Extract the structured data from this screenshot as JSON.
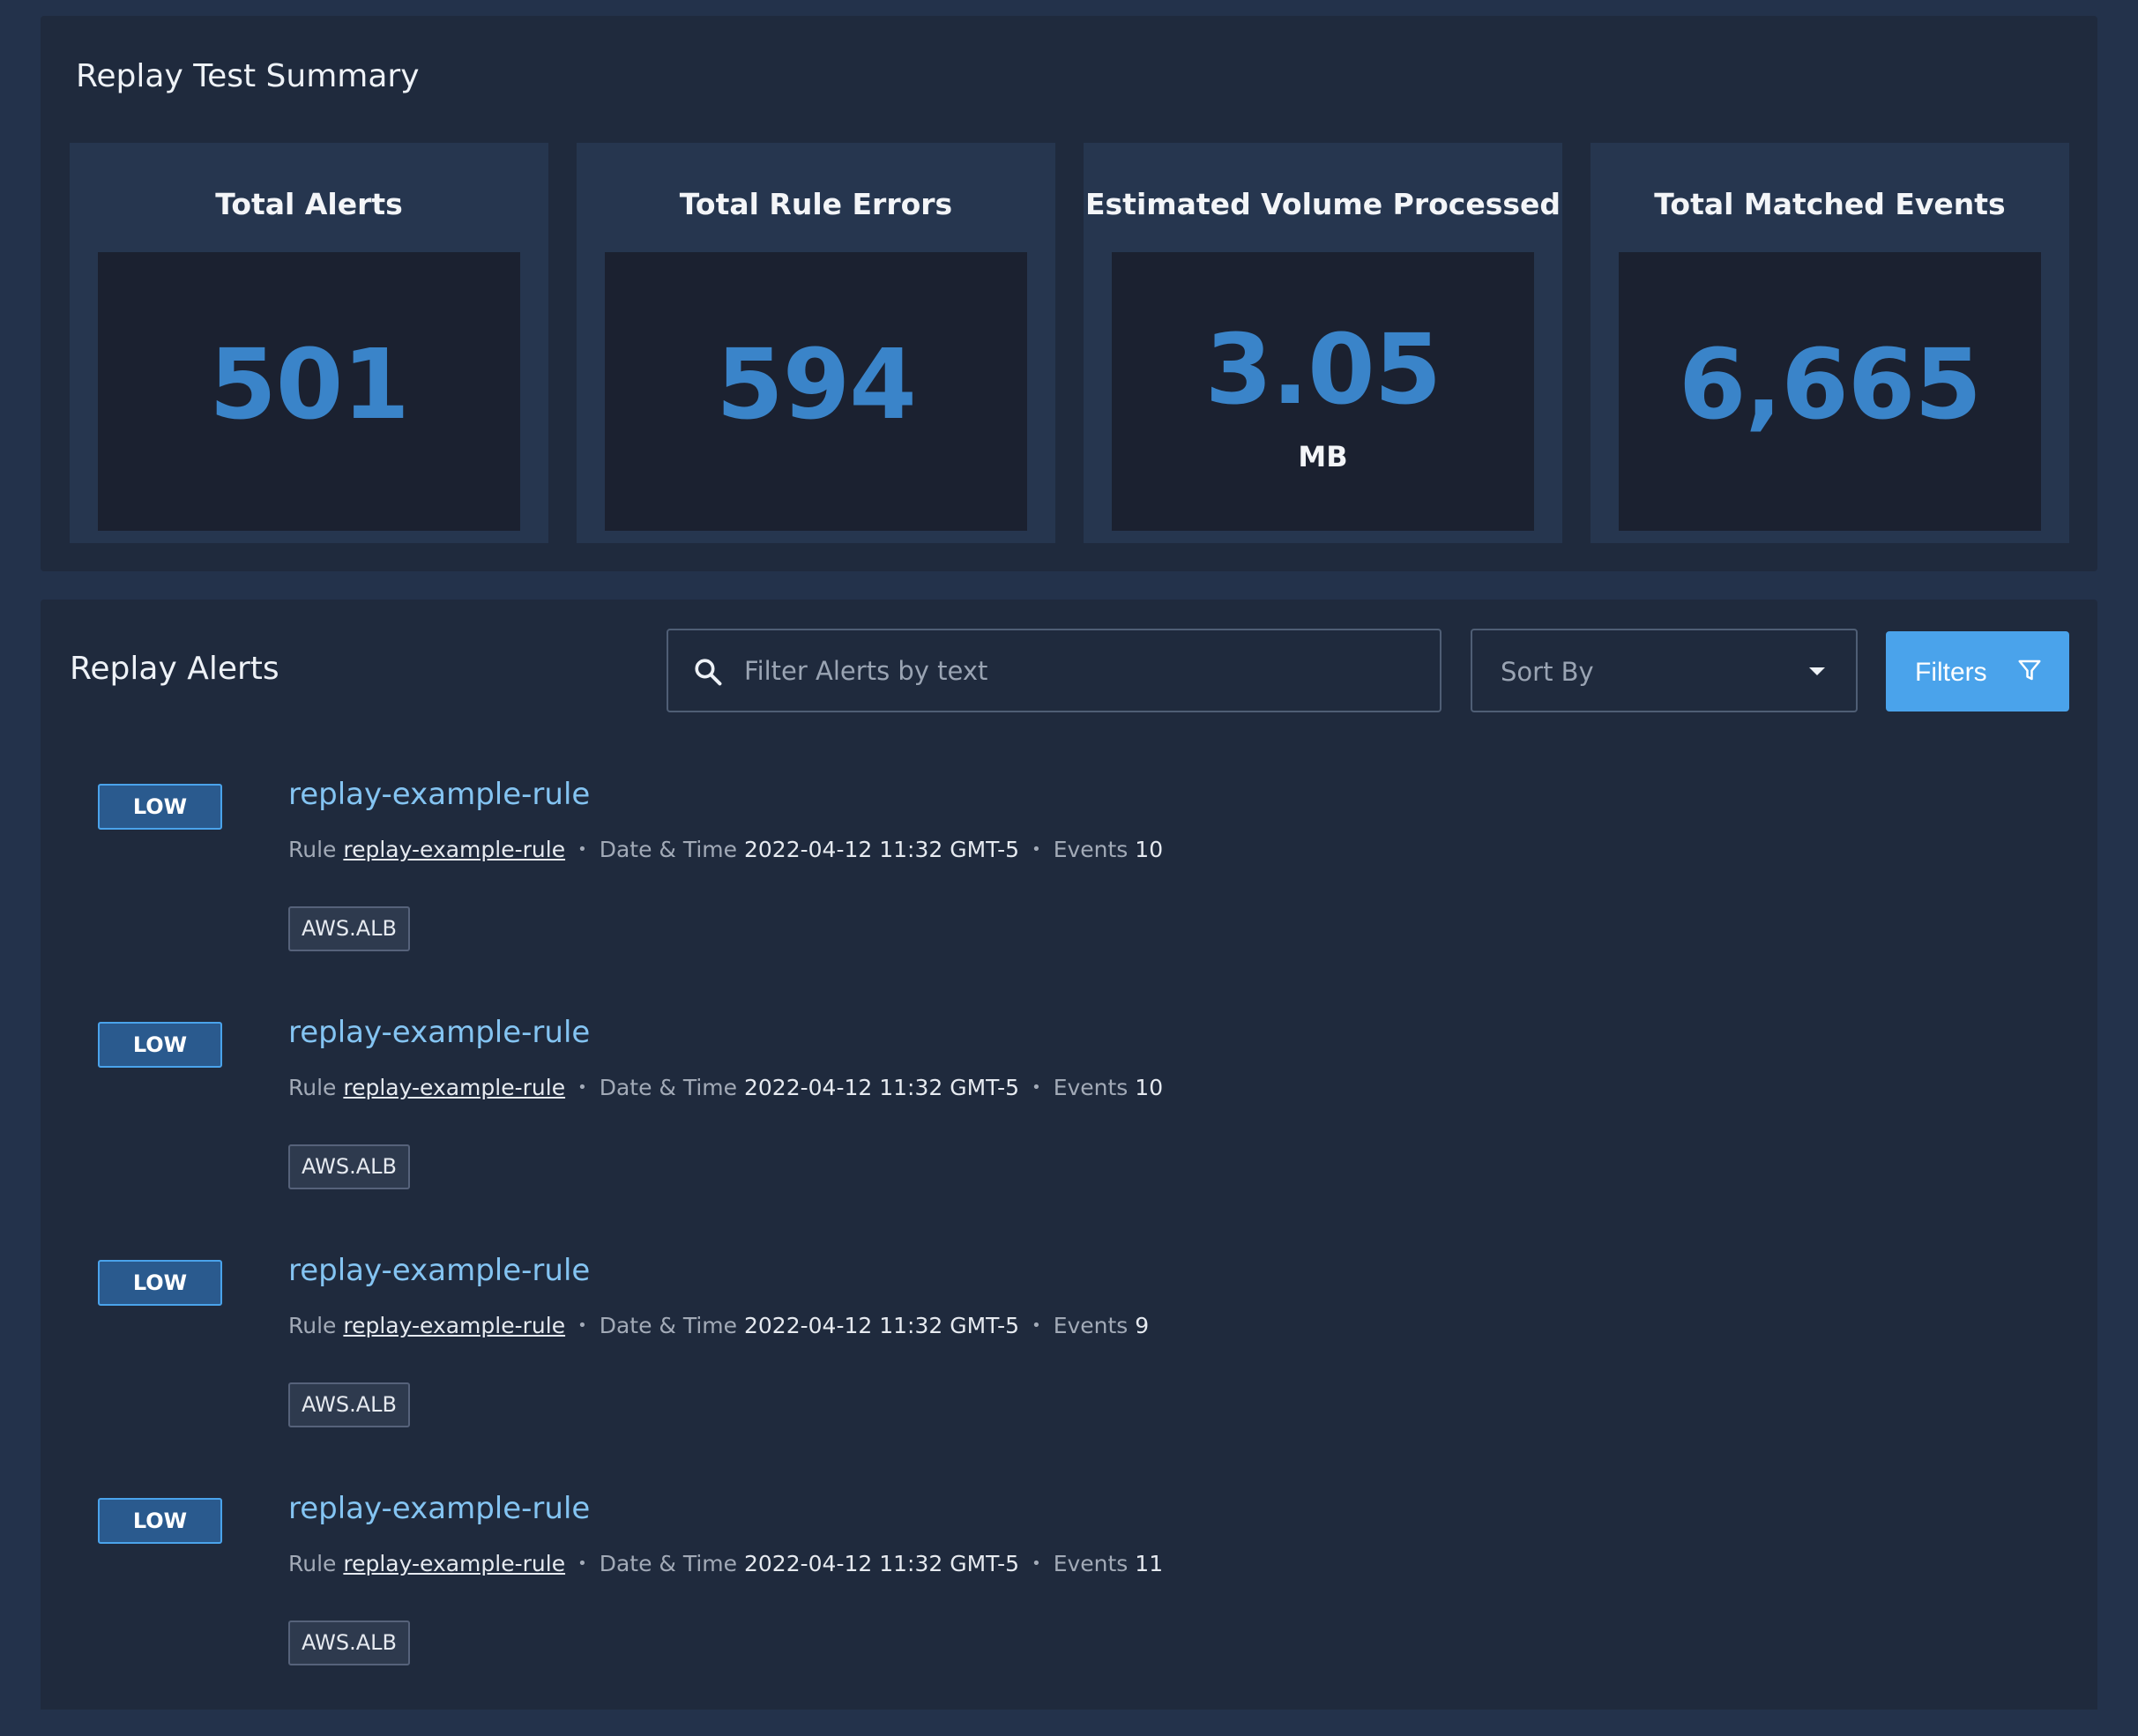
{
  "summary": {
    "title": "Replay Test Summary",
    "cards": [
      {
        "label": "Total Alerts",
        "value": "501",
        "unit": ""
      },
      {
        "label": "Total Rule Errors",
        "value": "594",
        "unit": ""
      },
      {
        "label": "Estimated Volume Processed",
        "value": "3.05",
        "unit": "MB"
      },
      {
        "label": "Total Matched Events",
        "value": "6,665",
        "unit": ""
      }
    ]
  },
  "alerts": {
    "title": "Replay Alerts",
    "search": {
      "placeholder": "Filter Alerts by text",
      "value": ""
    },
    "sort": {
      "label": "Sort By"
    },
    "filters_label": "Filters",
    "meta_labels": {
      "rule": "Rule",
      "datetime": "Date & Time",
      "events": "Events"
    },
    "items": [
      {
        "severity": "LOW",
        "title": "replay-example-rule",
        "rule": "replay-example-rule",
        "datetime": "2022-04-12 11:32 GMT-5",
        "events": "10",
        "log_type": "AWS.ALB"
      },
      {
        "severity": "LOW",
        "title": "replay-example-rule",
        "rule": "replay-example-rule",
        "datetime": "2022-04-12 11:32 GMT-5",
        "events": "10",
        "log_type": "AWS.ALB"
      },
      {
        "severity": "LOW",
        "title": "replay-example-rule",
        "rule": "replay-example-rule",
        "datetime": "2022-04-12 11:32 GMT-5",
        "events": "9",
        "log_type": "AWS.ALB"
      },
      {
        "severity": "LOW",
        "title": "replay-example-rule",
        "rule": "replay-example-rule",
        "datetime": "2022-04-12 11:32 GMT-5",
        "events": "11",
        "log_type": "AWS.ALB"
      }
    ]
  },
  "colors": {
    "background": "#23324b",
    "panel": "#1f2a3d",
    "accent": "#4aa3eb",
    "stat_value": "#3a84c9",
    "alert_title": "#84c4f2"
  },
  "icons": [
    "search-icon",
    "chevron-down-icon",
    "filter-icon"
  ]
}
